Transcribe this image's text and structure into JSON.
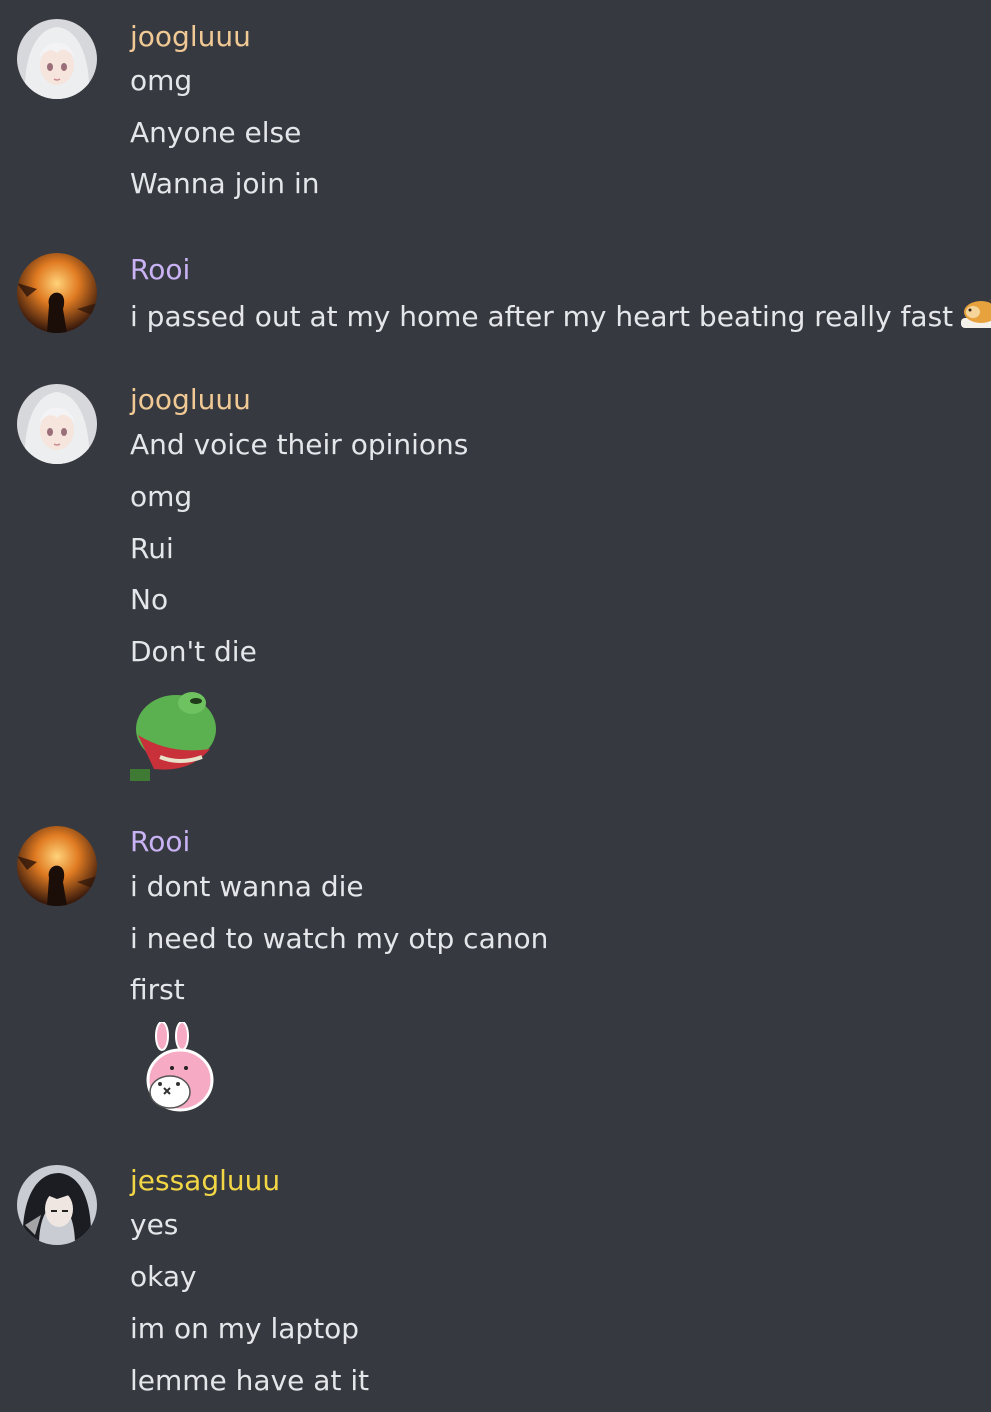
{
  "colors": {
    "background": "#36393f",
    "message_text": "#e4e6ea",
    "name_joogluuu": "#f0c995",
    "name_rooi": "#c9b3f5",
    "name_jessagluuu": "#f2d646"
  },
  "messages": [
    {
      "author": "joogluuu",
      "avatar_icon": "anime-girl-white-hair-avatar",
      "lines": [
        "omg",
        "Anyone else",
        "Wanna join in"
      ]
    },
    {
      "author": "Rooi",
      "avatar_icon": "sunset-silhouette-avatar",
      "lines": [
        "i passed out at my home after my heart beating really fast"
      ],
      "emoji": "sleeping-hamster-emoji"
    },
    {
      "author": "joogluuu",
      "avatar_icon": "anime-girl-white-hair-avatar",
      "lines": [
        "And voice their opinions",
        "omg",
        "Rui",
        "No",
        "Don't die"
      ],
      "sticker": "screaming-frog-sticker"
    },
    {
      "author": "Rooi",
      "avatar_icon": "sunset-silhouette-avatar",
      "lines": [
        "i dont wanna die",
        "i need to watch my otp canon",
        "first"
      ],
      "sticker": "pink-bunny-hug-sticker"
    },
    {
      "author": "jessagluuu",
      "avatar_icon": "dark-hair-character-avatar",
      "lines": [
        "yes",
        "okay",
        "im on my laptop",
        "lemme have at it"
      ]
    }
  ]
}
